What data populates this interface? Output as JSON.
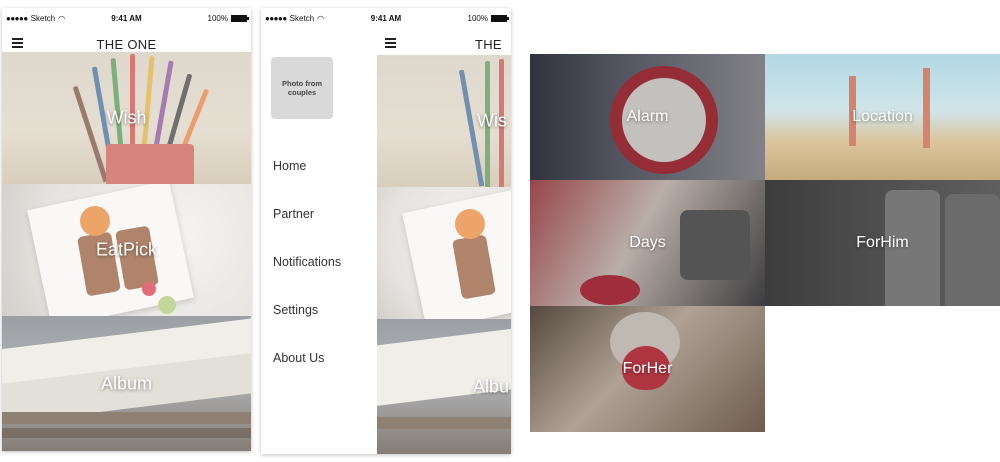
{
  "status_bar": {
    "carrier": "Sketch",
    "time": "9:41 AM",
    "battery": "100%"
  },
  "app": {
    "title": "THE ONE"
  },
  "screen1": {
    "tiles": [
      {
        "label": "Wish"
      },
      {
        "label": "EatPick"
      },
      {
        "label": "Album"
      }
    ]
  },
  "screen2": {
    "title_partial": "THE O",
    "photo_placeholder": "Photo from couples",
    "menu": [
      "Home",
      "Partner",
      "Notifications",
      "Settings",
      "About Us"
    ],
    "tiles_partial": [
      "Wis",
      "Albu"
    ]
  },
  "screen3": {
    "tiles": [
      {
        "label": "Alarm"
      },
      {
        "label": "Location"
      },
      {
        "label": "Days"
      },
      {
        "label": "ForHim"
      },
      {
        "label": "ForHer"
      }
    ]
  },
  "icons": {
    "menu": "hamburger-icon",
    "wifi": "wifi-icon",
    "battery": "battery-icon",
    "signal": "signal-dots-icon"
  }
}
